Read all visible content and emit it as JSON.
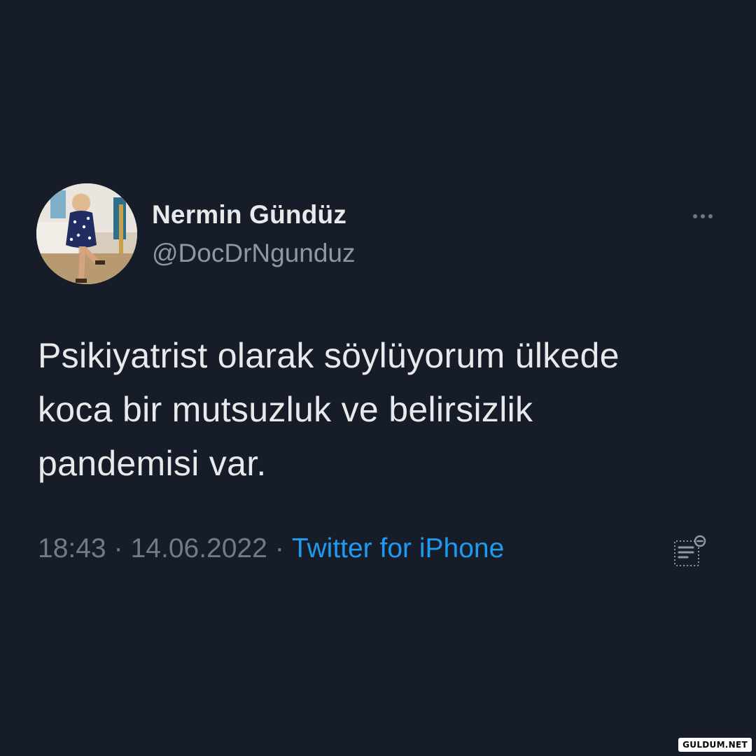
{
  "tweet": {
    "author": {
      "display_name": "Nermin Gündüz",
      "handle": "@DocDrNgunduz"
    },
    "text_lines": [
      "Psikiyatrist olarak söylüyorum ülkede",
      "koca bir mutsuzluk ve belirsizlik",
      "pandemisi var."
    ],
    "time": "18:43",
    "separator": "·",
    "date": "14.06.2022",
    "source": "Twitter for iPhone"
  },
  "icons": {
    "more": "more-options-icon",
    "analytics": "view-tweet-analytics-icon"
  },
  "watermark": "GULDUM.NET",
  "colors": {
    "background": "#161d29",
    "primary_text": "#e7e9ea",
    "secondary_text": "#8b98a5",
    "link": "#1d9bf0"
  }
}
